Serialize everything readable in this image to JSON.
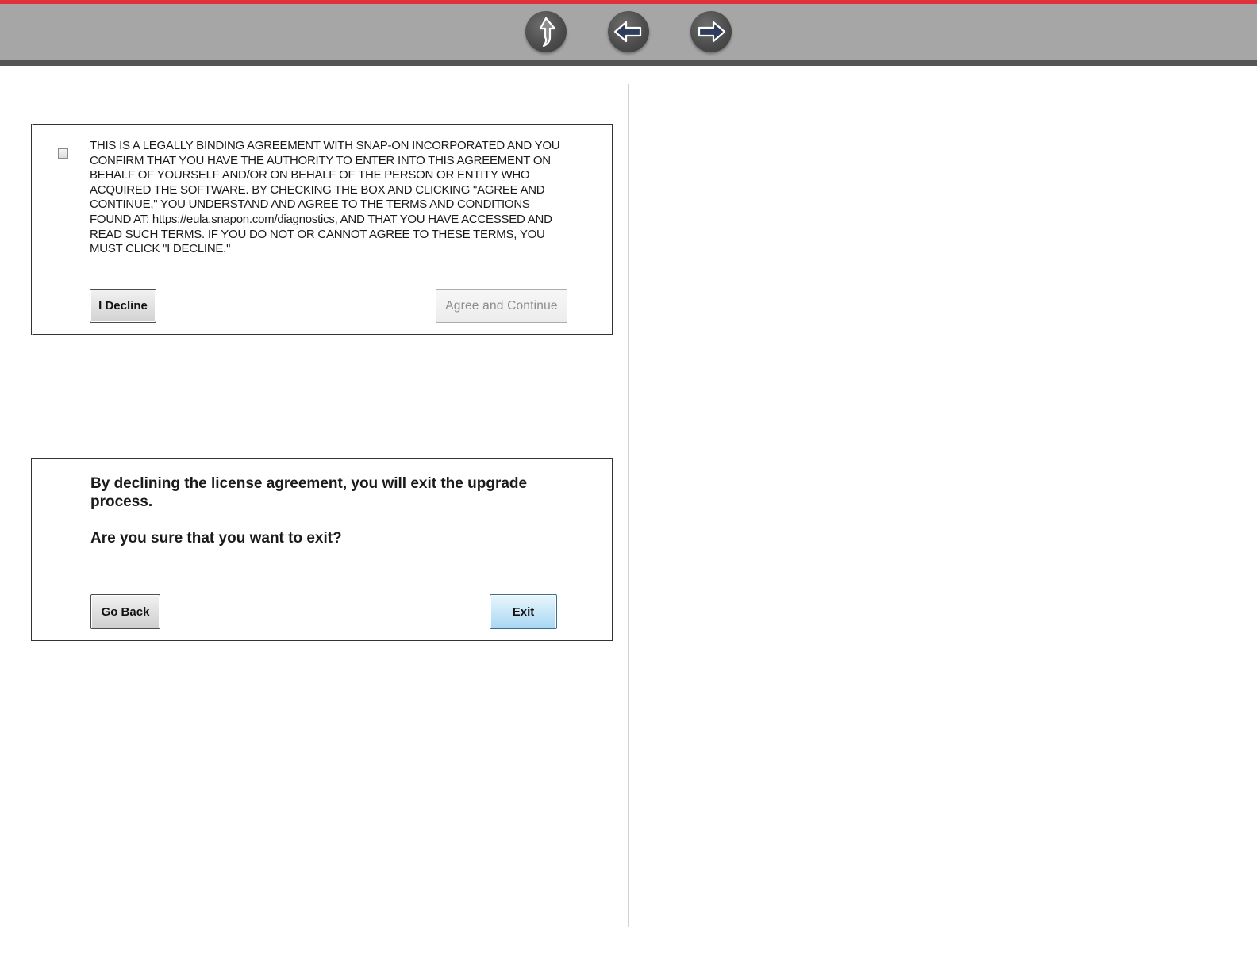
{
  "nav": {
    "buttons": [
      {
        "name": "up",
        "icon": "arrow-up-icon"
      },
      {
        "name": "back",
        "icon": "arrow-left-icon"
      },
      {
        "name": "forward",
        "icon": "arrow-right-icon"
      }
    ]
  },
  "colors": {
    "top_bar": "#a6a6a6",
    "top_accent": "#e0303a",
    "nav_button": "#4a4a4a",
    "exit_button": "#c9e7f8"
  },
  "eula_dialog": {
    "checkbox_checked": false,
    "text": "THIS IS A LEGALLY BINDING AGREEMENT WITH SNAP-ON INCORPORATED AND YOU CONFIRM THAT YOU HAVE THE AUTHORITY TO ENTER INTO THIS AGREEMENT ON BEHALF OF YOURSELF AND/OR ON BEHALF OF THE PERSON OR ENTITY WHO ACQUIRED THE SOFTWARE. BY CHECKING THE BOX AND CLICKING \"AGREE AND CONTINUE,\" YOU UNDERSTAND AND AGREE TO THE TERMS AND CONDITIONS FOUND AT: https://eula.snapon.com/diagnostics, AND THAT YOU HAVE ACCESSED AND READ SUCH TERMS. IF YOU DO NOT OR CANNOT AGREE TO THESE TERMS, YOU MUST CLICK \"I DECLINE.\"",
    "decline_label": "I Decline",
    "agree_label": "Agree and Continue"
  },
  "exit_dialog": {
    "message": "By declining the license agreement, you will exit the upgrade process.",
    "question": "Are you sure that you want to exit?",
    "go_back_label": "Go Back",
    "exit_label": "Exit"
  }
}
